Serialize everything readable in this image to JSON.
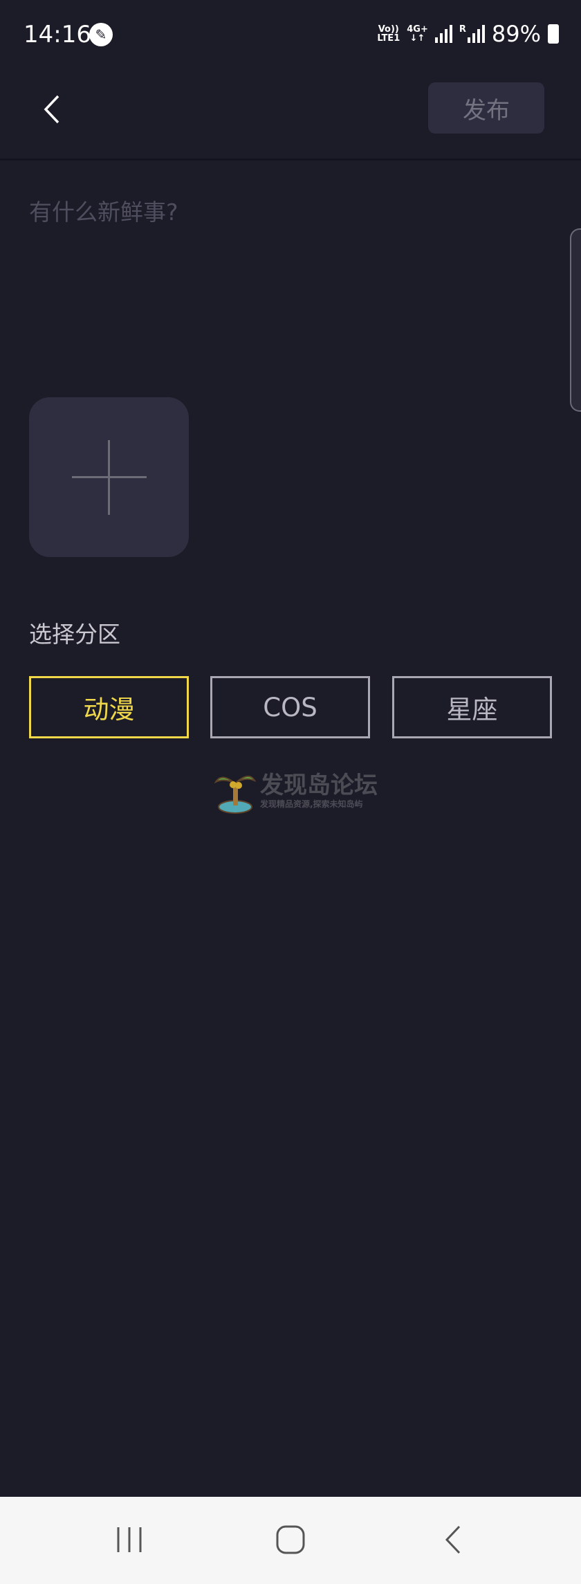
{
  "status_bar": {
    "time": "14:16",
    "network_top": "Vo))",
    "network_bottom": "LTE1",
    "data_top": "4G+",
    "data_bottom": "↓↑",
    "roaming": "R",
    "battery": "89%",
    "battery_level": 0.89
  },
  "header": {
    "publish_label": "发布"
  },
  "composer": {
    "placeholder": "有什么新鲜事?"
  },
  "section": {
    "label": "选择分区",
    "categories": [
      {
        "label": "动漫",
        "selected": true
      },
      {
        "label": "COS",
        "selected": false
      },
      {
        "label": "星座",
        "selected": false
      }
    ]
  },
  "watermark": {
    "title": "发现岛论坛",
    "subtitle": "发现精品资源,探索未知岛屿"
  },
  "colors": {
    "background": "#1c1b28",
    "accent": "#f0d84a",
    "button_bg": "#2e2d40"
  }
}
